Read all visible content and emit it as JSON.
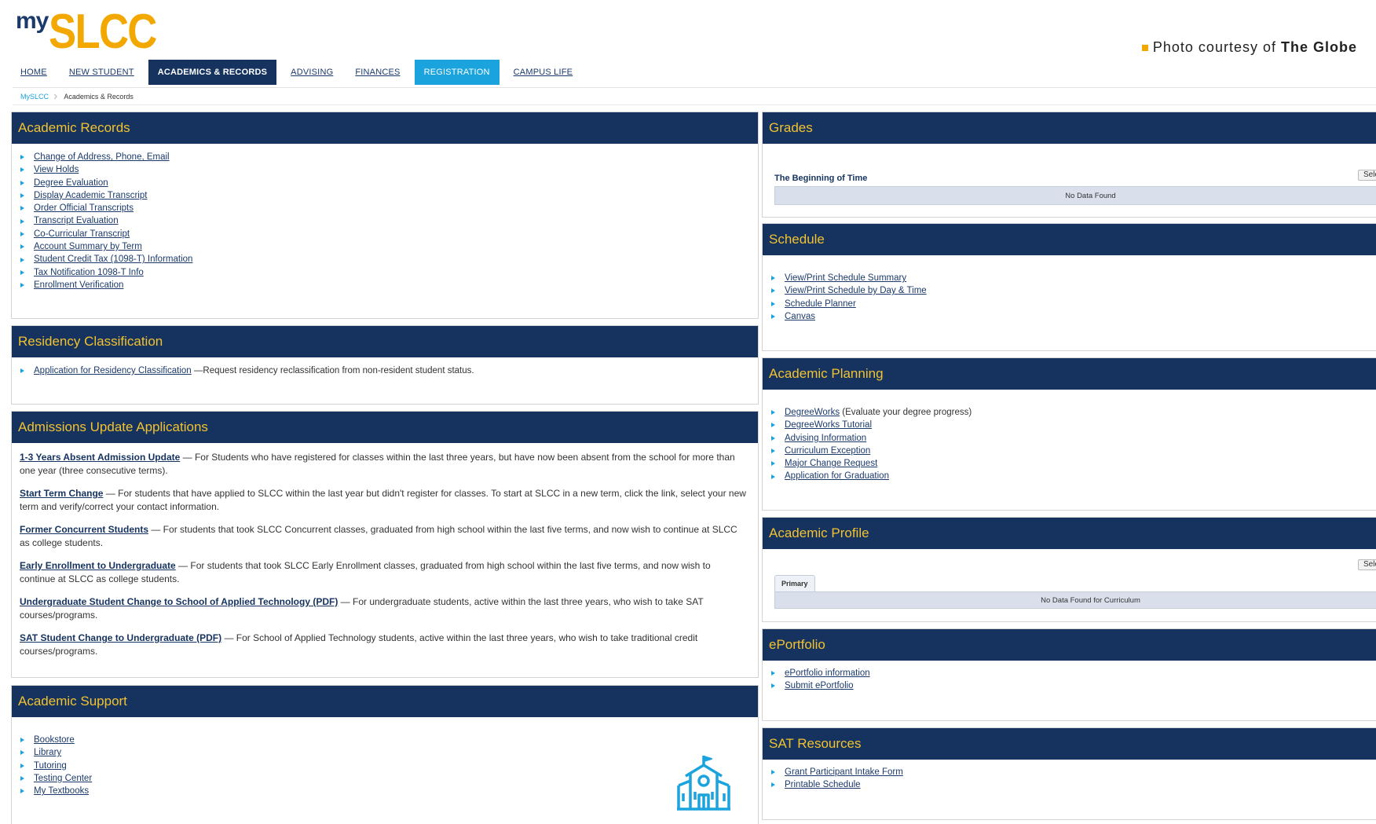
{
  "logo": {
    "my": "my",
    "slcc": "SLCC"
  },
  "credit": {
    "prefix": "Photo courtesy of",
    "source": "The Globe"
  },
  "nav": {
    "home": "HOME",
    "new_student": "NEW STUDENT",
    "academics": "ACADEMICS & RECORDS",
    "advising": "ADVISING",
    "finances": "FINANCES",
    "registration": "REGISTRATION",
    "campus_life": "CAMPUS LIFE"
  },
  "breadcrumb": {
    "root": "MySLCC",
    "current": "Academics & Records"
  },
  "colors": {
    "navy": "#15335e",
    "gold": "#f2c230",
    "logo_gold": "#f2a800",
    "accent_blue": "#1aa3dc"
  },
  "academic_records": {
    "title": "Academic Records",
    "links": [
      "Change of Address, Phone, Email",
      "View Holds",
      "Degree Evaluation",
      "Display Academic Transcript",
      "Order Official Transcripts",
      "Transcript Evaluation",
      "Co-Curricular Transcript",
      "Account Summary by Term",
      "Student Credit Tax (1098-T) Information",
      "Tax Notification 1098-T Info",
      "Enrollment Verification"
    ]
  },
  "residency": {
    "title": "Residency Classification",
    "link": "Application for Residency Classification",
    "desc": " —Request residency reclassification from non-resident student status."
  },
  "admissions": {
    "title": "Admissions Update Applications",
    "items": [
      {
        "link": "1-3 Years Absent Admission Update",
        "desc": " — For Students who have registered for classes within the last three years, but have now been absent from the school for more than one year (three consecutive terms)."
      },
      {
        "link": "Start Term Change",
        "desc": " — For students that have applied to SLCC within the last year but didn't register for classes. To start at SLCC in a new term, click the link, select your new term and verify/correct your contact information."
      },
      {
        "link": "Former Concurrent Students",
        "desc": " — For students that took SLCC Concurrent classes, graduated from high school within the last five terms, and now wish to continue at SLCC as college students."
      },
      {
        "link": "Early Enrollment to Undergraduate",
        "desc": " — For students that took SLCC Early Enrollment classes, graduated from high school within the last five terms, and now wish to continue at SLCC as college students."
      },
      {
        "link": "Undergraduate Student Change to School of Applied Technology (PDF)",
        "desc": " — For undergraduate students, active within the last three years, who wish to take SAT courses/programs."
      },
      {
        "link": "SAT Student Change to Undergraduate (PDF)",
        "desc": " — For School of Applied Technology students, active within the last three years, who wish to take traditional credit courses/programs."
      }
    ]
  },
  "academic_support": {
    "title": "Academic Support",
    "links": [
      "Bookstore",
      "Library",
      "Tutoring",
      "Testing Center",
      "My Textbooks"
    ],
    "icon": "school-building-icon"
  },
  "grades": {
    "title": "Grades",
    "term": "The Beginning of Time",
    "select": "Select",
    "empty": "No Data Found"
  },
  "schedule": {
    "title": "Schedule",
    "links": [
      "View/Print Schedule Summary",
      "View/Print Schedule by Day & Time",
      "Schedule Planner",
      "Canvas"
    ]
  },
  "academic_planning": {
    "title": "Academic Planning",
    "links": [
      {
        "label": "DegreeWorks",
        "suffix": " (Evaluate your degree progress)"
      },
      {
        "label": "DegreeWorks Tutorial",
        "suffix": ""
      },
      {
        "label": "Advising Information",
        "suffix": ""
      },
      {
        "label": "Curriculum Exception",
        "suffix": ""
      },
      {
        "label": "Major Change Request",
        "suffix": ""
      },
      {
        "label": "Application for Graduation",
        "suffix": ""
      }
    ]
  },
  "academic_profile": {
    "title": "Academic Profile",
    "select": "Select",
    "tab": "Primary",
    "empty": "No Data Found for Curriculum"
  },
  "eportfolio": {
    "title": "ePortfolio",
    "links": [
      "ePortfolio information",
      "Submit ePortfolio"
    ]
  },
  "sat_resources": {
    "title": "SAT Resources",
    "links": [
      "Grant Participant Intake Form",
      "Printable Schedule"
    ]
  }
}
